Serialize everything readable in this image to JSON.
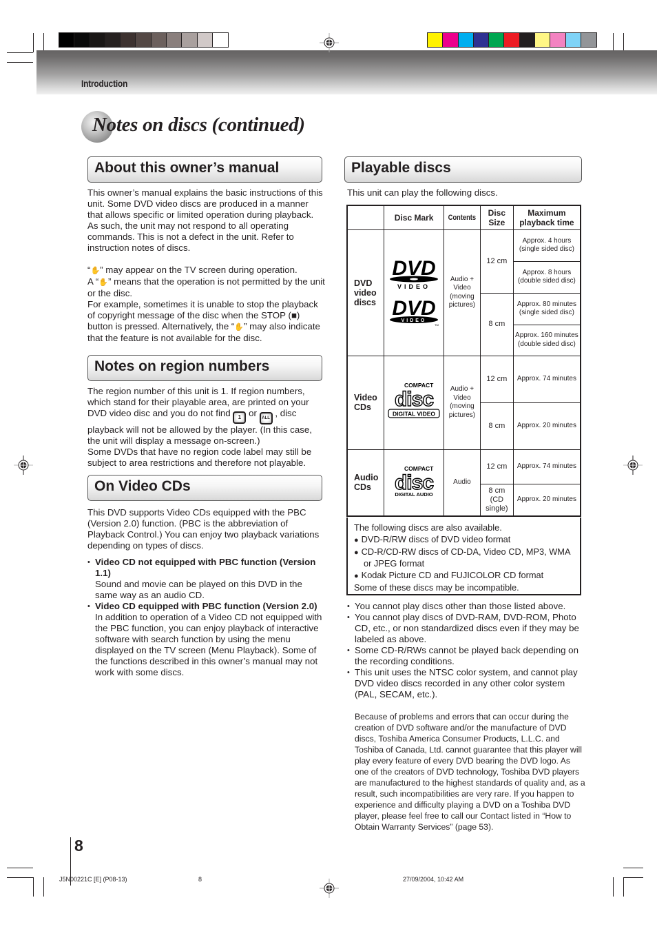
{
  "print_marks": {
    "gray_swatches": [
      "#000000",
      "#0a0a0a",
      "#1a1716",
      "#262120",
      "#3d3230",
      "#544845",
      "#6c605d",
      "#8a7f7d",
      "#a9a09e",
      "#d1c9c8",
      "#ffffff"
    ],
    "color_swatches": [
      "#fff200",
      "#ec008c",
      "#00aeef",
      "#2e3192",
      "#00a651",
      "#ed1c24",
      "#231f20",
      "#fff685",
      "#f383c1",
      "#7fd3f7",
      "#939598"
    ]
  },
  "header": {
    "section_label": "Introduction"
  },
  "page_title": "Notes on discs (continued)",
  "left_column": {
    "about": {
      "heading": "About this owner’s manual",
      "para1": "This owner’s manual explains the basic instructions of this unit. Some DVD video discs are produced in a manner that allows specific or limited operation during playback. As such, the unit may not respond to all operating commands. This is not a defect in the unit. Refer to instruction notes of discs.",
      "para2_line1_pre": "“",
      "para2_line1_post": "” may appear on the TV screen during operation.",
      "para2_line2_pre": "A “",
      "para2_line2_post": "” means that the operation is not permitted by the unit or the disc.",
      "para2_line3": "For example, sometimes it is unable to stop the playback of copyright message of the disc when the STOP (■) button is pressed. Alternatively, the “",
      "para2_line3_post": "” may also indicate that the feature is not available for the disc.",
      "prohibited_icon": "hand-prohibited-icon"
    },
    "region": {
      "heading": "Notes on region numbers",
      "para_pre": "The region number of this unit is 1. If region numbers, which stand for their playable area, are printed on your DVD video disc and you do not find ",
      "icon1_label": "1",
      "para_mid": " or ",
      "icon2_label": "ALL",
      "para_post": " , disc playback will not be allowed by the player. (In this case, the unit will display a message on-screen.)",
      "para2": "Some DVDs that have no region code label may still be subject to area restrictions and therefore not playable."
    },
    "vcd": {
      "heading": "On Video CDs",
      "intro": "This DVD supports Video CDs equipped with the PBC (Version 2.0) function. (PBC is the abbreviation of Playback Control.) You can enjoy two playback variations depending on types of discs.",
      "items": [
        {
          "title": "Video CD not equipped with PBC function (Version 1.1)",
          "body": "Sound and movie can be played on this DVD in the same way as an audio CD."
        },
        {
          "title": "Video CD equipped with PBC function (Version 2.0)",
          "body": "In addition to operation of a Video CD not equipped with the PBC function, you can enjoy playback of interactive software with search function by using the menu displayed on the TV screen (Menu Playback). Some of the functions described in this owner’s manual may not work with some discs."
        }
      ]
    }
  },
  "right_column": {
    "heading": "Playable discs",
    "intro": "This unit can play the following discs.",
    "table": {
      "headers": [
        "",
        "Disc Mark",
        "Contents",
        "Disc Size",
        "Maximum playback time"
      ],
      "dvd": {
        "label": "DVD video discs",
        "logo": "dvd-video-logo",
        "logo_text": "VIDEO",
        "contents": "Audio + Video (moving pictures)",
        "sizes": [
          {
            "size": "12 cm",
            "times": [
              "Approx. 4 hours (single sided disc)",
              "Approx. 8 hours (double sided disc)"
            ]
          },
          {
            "size": "8 cm",
            "times": [
              "Approx. 80 minutes (single sided disc)",
              "Approx. 160 minutes (double sided disc)"
            ]
          }
        ]
      },
      "vcd": {
        "label": "Video CDs",
        "logo": "compact-disc-digital-video-logo",
        "logo_top": "COMPACT",
        "logo_bottom": "DIGITAL VIDEO",
        "contents": "Audio + Video (moving pictures)",
        "rows": [
          {
            "size": "12 cm",
            "time": "Approx. 74 minutes"
          },
          {
            "size": "8 cm",
            "time": "Approx. 20 minutes"
          }
        ]
      },
      "acd": {
        "label": "Audio CDs",
        "logo": "compact-disc-digital-audio-logo",
        "logo_top": "COMPACT",
        "logo_bottom": "DIGITAL AUDIO",
        "contents": "Audio",
        "rows": [
          {
            "size": "12 cm",
            "time": "Approx. 74 minutes"
          },
          {
            "size": "8 cm (CD single)",
            "time": "Approx. 20 minutes"
          }
        ]
      }
    },
    "also_available": {
      "intro": "The following discs are also available.",
      "items": [
        "DVD-R/RW discs of DVD video format",
        "CD-R/CD-RW discs of CD-DA, Video CD, MP3, WMA",
        "Kodak Picture CD and FUJICOLOR CD format"
      ],
      "item2_cont": "or JPEG format",
      "note": "Some of these discs may be incompatible."
    },
    "bullets": [
      "You cannot play discs other than those listed above.",
      "You cannot play discs of DVD-RAM, DVD-ROM, Photo CD, etc., or non standardized discs even if they may be labeled as above.",
      "Some CD-R/RWs cannot be played back depending on the recording conditions.",
      "This unit uses the NTSC color system, and cannot play DVD video discs recorded in any other color system (PAL, SECAM, etc.)."
    ],
    "disclaimer": "Because of problems and errors that can occur during the creation of DVD software and/or the manufacture of DVD discs, Toshiba America Consumer Products, L.L.C. and Toshiba of Canada, Ltd. cannot guarantee that this player will play every feature of every DVD bearing the DVD logo. As one of the creators of DVD technology, Toshiba DVD players are manufactured to the highest standards of quality and, as a result, such incompatibilities are very rare. If you happen to experience and difficulty playing a DVD on a Toshiba DVD player, please feel free to call our Contact listed in “How to Obtain Warranty Services” (page 53)."
  },
  "page_number": "8",
  "footer": {
    "doc_code": "J5N00221C [E] (P08-13)",
    "page": "8",
    "timestamp": "27/09/2004, 10:42 AM"
  }
}
